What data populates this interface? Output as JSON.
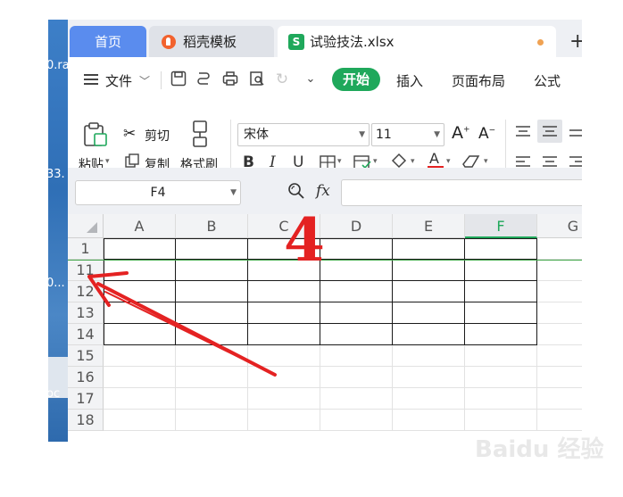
{
  "desktop": {
    "labels": [
      "0.ra",
      "33.",
      "0...",
      "oc"
    ]
  },
  "tabs": [
    {
      "label": "首页"
    },
    {
      "label": "稻壳模板"
    },
    {
      "label": "试验技法.xlsx"
    }
  ],
  "menu": {
    "file_label": "文件",
    "active_label": "开始",
    "items": [
      "插入",
      "页面布局",
      "公式"
    ]
  },
  "toolbar": {
    "paste_label": "粘贴",
    "cut_label": "剪切",
    "copy_label": "复制",
    "format_painter_label": "格式刷",
    "font_name": "宋体",
    "font_size": "11"
  },
  "formula_bar": {
    "cell_ref": "F4",
    "fx_label": "fx"
  },
  "sheet": {
    "columns": [
      "A",
      "B",
      "C",
      "D",
      "E",
      "F",
      "G"
    ],
    "selected_column": "F",
    "rows": [
      "1",
      "11",
      "12",
      "13",
      "14",
      "15",
      "16",
      "17",
      "18"
    ]
  },
  "annotation": {
    "step": "4"
  },
  "watermark": "Baidu 经验",
  "colors": {
    "accent": "#1fa85b",
    "home_tab": "#5a8cee",
    "annotation": "#e42222"
  }
}
